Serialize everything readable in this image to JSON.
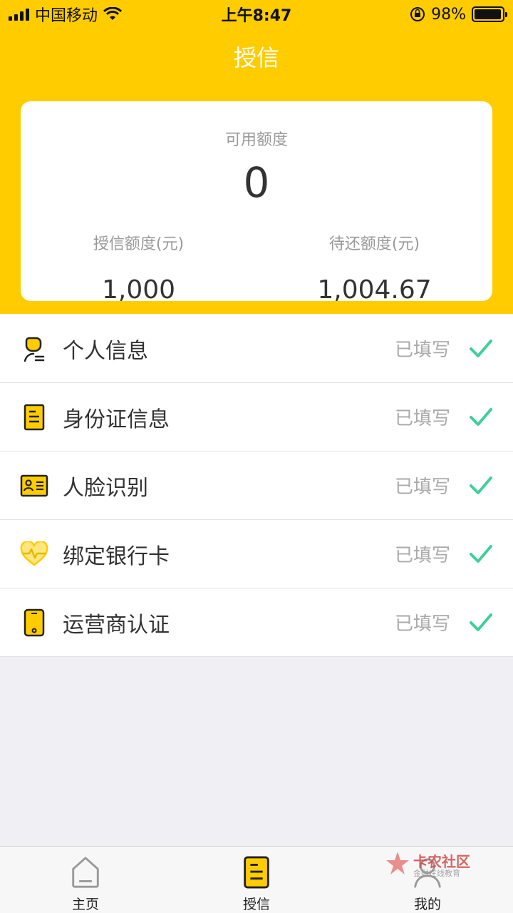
{
  "status_bar": {
    "carrier": "中国移动",
    "time": "上午8:47",
    "battery": "98%",
    "battery_level": 0.98
  },
  "nav": {
    "title": "授信"
  },
  "card": {
    "available_label": "可用额度",
    "available_value": "0",
    "credit_label": "授信额度(元)",
    "credit_value": "1,000",
    "repay_label": "待还额度(元)",
    "repay_value": "1,004.67"
  },
  "list": {
    "items": [
      {
        "label": "个人信息",
        "status": "已填写",
        "icon": "user-icon"
      },
      {
        "label": "身份证信息",
        "status": "已填写",
        "icon": "id-document-icon"
      },
      {
        "label": "人脸识别",
        "status": "已填写",
        "icon": "id-card-icon"
      },
      {
        "label": "绑定银行卡",
        "status": "已填写",
        "icon": "heart-pulse-icon"
      },
      {
        "label": "运营商认证",
        "status": "已填写",
        "icon": "phone-icon"
      }
    ]
  },
  "tabbar": {
    "tabs": [
      {
        "label": "主页",
        "icon": "home-icon"
      },
      {
        "label": "授信",
        "icon": "credit-doc-icon"
      },
      {
        "label": "我的",
        "icon": "profile-icon"
      }
    ]
  },
  "watermark": {
    "text": "卡农社区",
    "sub": "金融在线教育"
  },
  "colors": {
    "brand": "#ffcc00",
    "check": "#3ecf9a",
    "background": "#efeff4"
  }
}
